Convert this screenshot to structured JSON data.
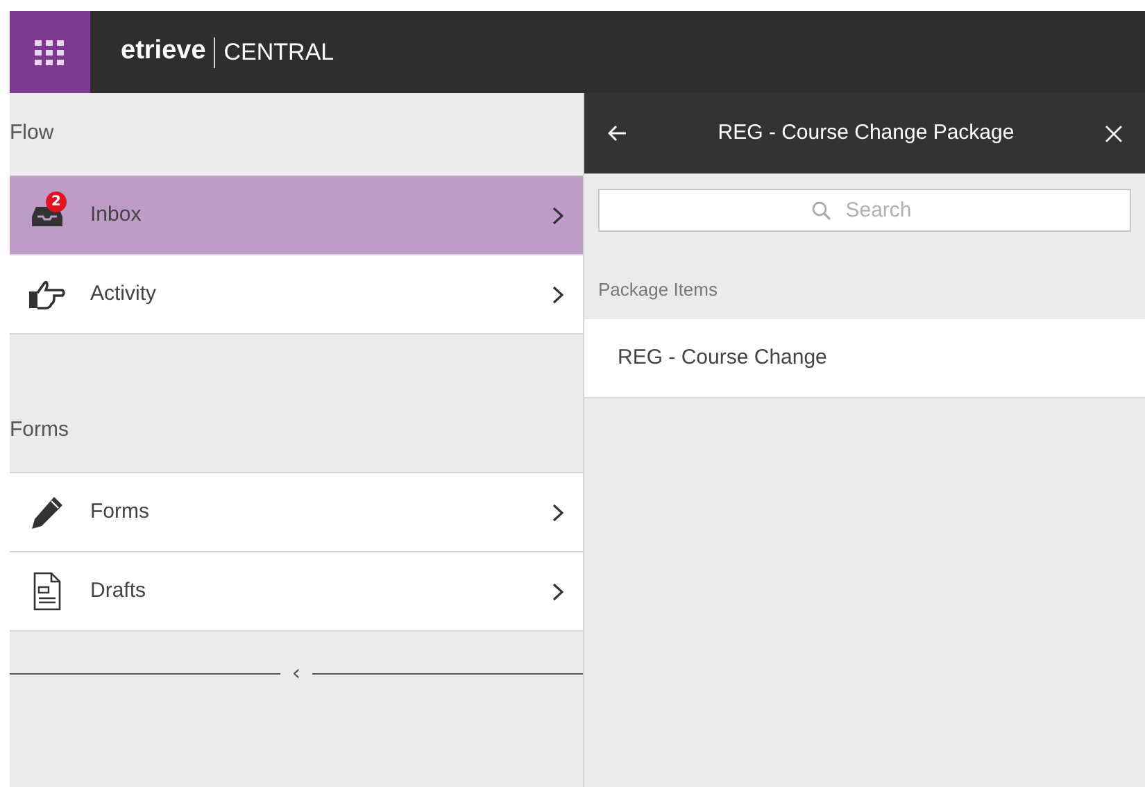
{
  "app": {
    "logo": "etrieve",
    "product": "CENTRAL"
  },
  "sidebar": {
    "sections": [
      {
        "title": "Flow",
        "items": [
          {
            "label": "Inbox",
            "badge": "2",
            "selected": true
          },
          {
            "label": "Activity",
            "selected": false
          }
        ]
      },
      {
        "title": "Forms",
        "items": [
          {
            "label": "Forms",
            "selected": false
          },
          {
            "label": "Drafts",
            "selected": false
          }
        ]
      }
    ],
    "collapse": "‹"
  },
  "panel": {
    "title": "REG - Course Change Package",
    "search": {
      "placeholder": "Search"
    },
    "section_label": "Package Items",
    "items": [
      "REG - Course Change"
    ]
  }
}
